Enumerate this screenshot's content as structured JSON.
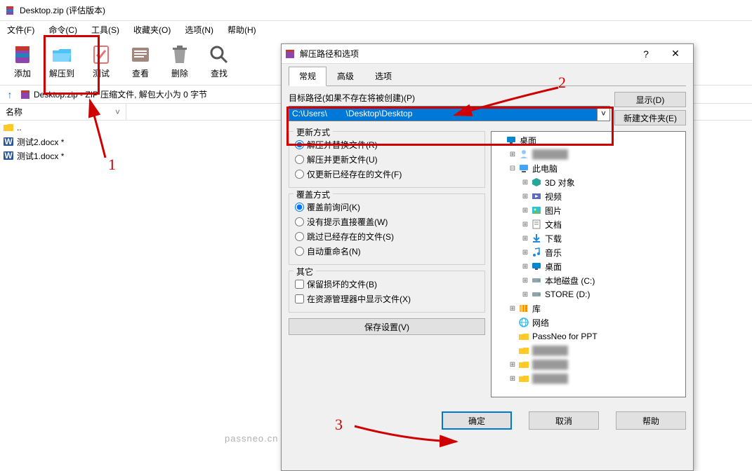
{
  "main": {
    "title": "Desktop.zip (评估版本)",
    "menu": [
      "文件(F)",
      "命令(C)",
      "工具(S)",
      "收藏夹(O)",
      "选项(N)",
      "帮助(H)"
    ],
    "toolbar": [
      {
        "id": "add",
        "label": "添加"
      },
      {
        "id": "extract",
        "label": "解压到"
      },
      {
        "id": "test",
        "label": "测试"
      },
      {
        "id": "view",
        "label": "查看"
      },
      {
        "id": "delete",
        "label": "删除"
      },
      {
        "id": "find",
        "label": "查找"
      }
    ],
    "path": "Desktop.zip - ZIP 压缩文件, 解包大小为 0 字节",
    "col_name": "名称",
    "files": [
      {
        "name": "..",
        "icon": "folder"
      },
      {
        "name": "测试2.docx *",
        "icon": "word"
      },
      {
        "name": "测试1.docx *",
        "icon": "word"
      }
    ]
  },
  "dlg": {
    "title": "解压路径和选项",
    "help_icon": "?",
    "close_icon": "✕",
    "tabs": [
      "常规",
      "高级",
      "选项"
    ],
    "path_label": "目标路径(如果不存在将被创建)(P)",
    "path_value": "C:\\Users\\        \\Desktop\\Desktop",
    "btn_display": "显示(D)",
    "btn_newfolder": "新建文件夹(E)",
    "group_update": "更新方式",
    "update_opts": [
      "解压并替换文件(R)",
      "解压并更新文件(U)",
      "仅更新已经存在的文件(F)"
    ],
    "group_overwrite": "覆盖方式",
    "overwrite_opts": [
      "覆盖前询问(K)",
      "没有提示直接覆盖(W)",
      "跳过已经存在的文件(S)",
      "自动重命名(N)"
    ],
    "group_other": "其它",
    "other_opts": [
      "保留损坏的文件(B)",
      "在资源管理器中显示文件(X)"
    ],
    "btn_save": "保存设置(V)",
    "tree": [
      {
        "depth": 0,
        "exp": "",
        "icon": "desktop",
        "label": "桌面",
        "selected": false
      },
      {
        "depth": 1,
        "exp": "⊞",
        "icon": "user",
        "label": "",
        "blur": true
      },
      {
        "depth": 1,
        "exp": "⊟",
        "icon": "pc",
        "label": "此电脑"
      },
      {
        "depth": 2,
        "exp": "⊞",
        "icon": "3d",
        "label": "3D 对象"
      },
      {
        "depth": 2,
        "exp": "⊞",
        "icon": "video",
        "label": "视频"
      },
      {
        "depth": 2,
        "exp": "⊞",
        "icon": "pic",
        "label": "图片"
      },
      {
        "depth": 2,
        "exp": "⊞",
        "icon": "doc",
        "label": "文档"
      },
      {
        "depth": 2,
        "exp": "⊞",
        "icon": "down",
        "label": "下载"
      },
      {
        "depth": 2,
        "exp": "⊞",
        "icon": "music",
        "label": "音乐"
      },
      {
        "depth": 2,
        "exp": "⊞",
        "icon": "desktop",
        "label": "桌面"
      },
      {
        "depth": 2,
        "exp": "⊞",
        "icon": "disk",
        "label": "本地磁盘 (C:)"
      },
      {
        "depth": 2,
        "exp": "⊞",
        "icon": "disk",
        "label": "STORE (D:)"
      },
      {
        "depth": 1,
        "exp": "⊞",
        "icon": "lib",
        "label": "库"
      },
      {
        "depth": 1,
        "exp": "",
        "icon": "net",
        "label": "网络"
      },
      {
        "depth": 1,
        "exp": "",
        "icon": "folder",
        "label": "PassNeo for PPT"
      },
      {
        "depth": 1,
        "exp": "",
        "icon": "folder",
        "label": "",
        "blur": true
      },
      {
        "depth": 1,
        "exp": "⊞",
        "icon": "folder",
        "label": "",
        "blur": true
      },
      {
        "depth": 1,
        "exp": "⊞",
        "icon": "folder",
        "label": "",
        "blur": true
      }
    ],
    "btn_ok": "确定",
    "btn_cancel": "取消",
    "btn_help": "帮助"
  },
  "anno": {
    "n1": "1",
    "n2": "2",
    "n3": "3"
  },
  "watermark": "passneo.cn"
}
